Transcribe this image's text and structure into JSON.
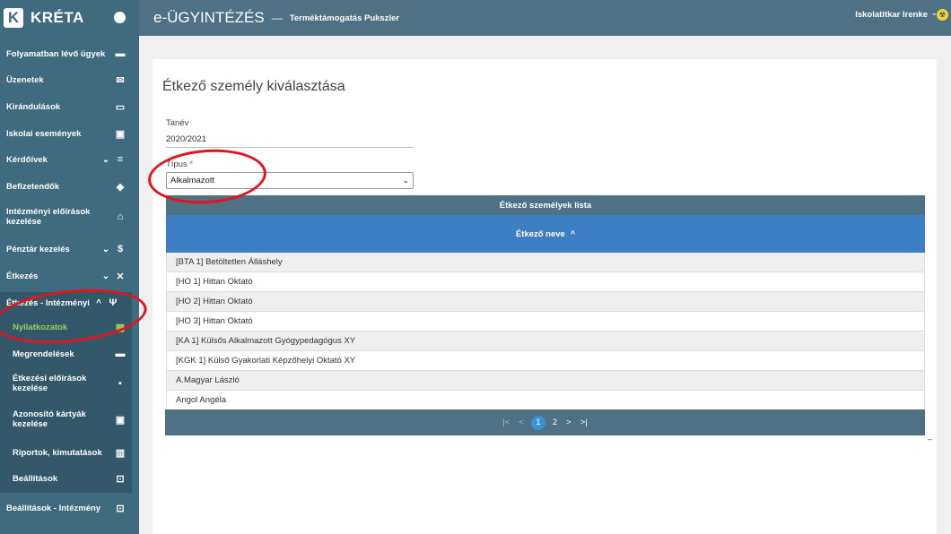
{
  "sidebar": {
    "logo_mark": "K",
    "logo_text": "KRÉTA",
    "items": [
      {
        "label": "Folyamatban lévő ügyek",
        "icon": "▬"
      },
      {
        "label": "Üzenetek",
        "icon": "✉"
      },
      {
        "label": "Kirándulások",
        "icon": "▭"
      },
      {
        "label": "Iskolai események",
        "icon": "▣"
      },
      {
        "label": "Kérdőívek",
        "icon": "≡",
        "chev": "⌄"
      },
      {
        "label": "Befizetendők",
        "icon": "◈"
      },
      {
        "label": "Intézményi előírások kezelése",
        "icon": "⌂"
      },
      {
        "label": "Pénztár kezelés",
        "icon": "$",
        "chev": "⌄"
      },
      {
        "label": "Étkezés",
        "icon": "✕",
        "chev": "⌄"
      },
      {
        "label": "Étkezés - Intézményi",
        "icon": "Ψ",
        "chev": "^"
      }
    ],
    "subitems": [
      {
        "label": "Nyilatkozatok",
        "icon": "▦"
      },
      {
        "label": "Megrendelések",
        "icon": "▬"
      },
      {
        "label": "Étkezési előírások kezelése",
        "icon": "▪"
      },
      {
        "label": "Azonosító kártyák kezelése",
        "icon": "▣"
      },
      {
        "label": "Riportok, kimutatások",
        "icon": "▥"
      },
      {
        "label": "Beállítások",
        "icon": "⊡"
      }
    ],
    "bottom_item": {
      "label": "Beállítások - Intézmény",
      "icon": "⊡"
    }
  },
  "topbar": {
    "title": "e-ÜGYINTÉZÉS",
    "dash": "—",
    "subtitle": "Terméktámogatás Pukszler",
    "user": "Iskolatitkar Irenke",
    "user_chev": "⌄",
    "user_icon": "☢"
  },
  "form": {
    "page_title": "Étkező személy kiválasztása",
    "tanev_label": "Tanév",
    "tanev_value": "2020/2021",
    "tipus_label": "Típus",
    "tipus_required": "*",
    "tipus_value": "Alkalmazott",
    "tipus_caret": "⌄"
  },
  "grid": {
    "title": "Étkező személyek lista",
    "column": "Étkező neve",
    "sort_icon": "^",
    "rows": [
      "[BTA 1] Betöltetlen Álláshely",
      "[HO 1] Hittan Oktató",
      "[HO 2] Hittan Oktató",
      "[HO 3] Hittan Oktató",
      "[KA 1] Külsős Alkalmazott Gyógypedagógus XY",
      "[KGK 1] Külső Gyakorlati Képzőhelyi Oktató XY",
      "A.Magyar László",
      "Angol Angéla"
    ],
    "pager": {
      "first": "|<",
      "prev": "<",
      "page1": "1",
      "page2": "2",
      "next": ">",
      "last": ">|"
    }
  },
  "colors": {
    "sidebar": "#3f6b7e",
    "topbar": "#4e7284",
    "header_blue": "#3d7fc4",
    "active_green": "#9ccc65",
    "annotation_red": "#e3141b"
  }
}
